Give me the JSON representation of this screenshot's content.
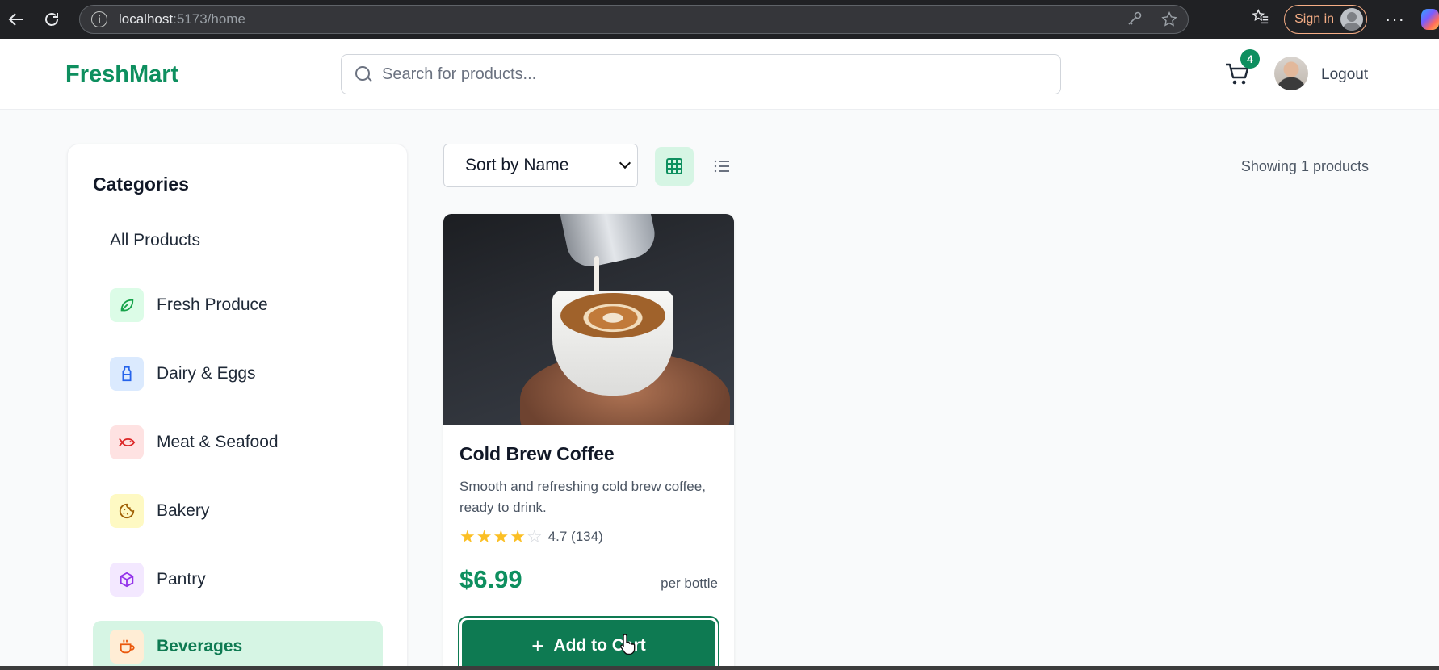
{
  "browser": {
    "url_host": "localhost",
    "url_rest": ":5173/home",
    "signin_label": "Sign in",
    "more_label": "···"
  },
  "header": {
    "logo": "FreshMart",
    "search_placeholder": "Search for products...",
    "cart_count": "4",
    "logout_label": "Logout"
  },
  "sidebar": {
    "title": "Categories",
    "items": [
      {
        "label": "All Products",
        "icon": "none",
        "color": ""
      },
      {
        "label": "Fresh Produce",
        "icon": "leaf-icon",
        "color": "#dcfce7"
      },
      {
        "label": "Dairy & Eggs",
        "icon": "milk-bottle-icon",
        "color": "#dbeafe"
      },
      {
        "label": "Meat & Seafood",
        "icon": "fish-icon",
        "color": "#fee2e2"
      },
      {
        "label": "Bakery",
        "icon": "cookie-icon",
        "color": "#fef9c3"
      },
      {
        "label": "Pantry",
        "icon": "package-icon",
        "color": "#f3e8ff"
      },
      {
        "label": "Beverages",
        "icon": "coffee-cup-icon",
        "color": "#ffedd5",
        "active": true
      }
    ]
  },
  "toolbar": {
    "sort_value": "Sort by Name",
    "showing_text": "Showing 1 products"
  },
  "product": {
    "name": "Cold Brew Coffee",
    "description": "Smooth and refreshing cold brew coffee, ready to drink.",
    "rating": "4.7",
    "rating_count": "(134)",
    "stars_filled": 4,
    "stars_total": 5,
    "price": "$6.99",
    "unit": "per bottle",
    "add_label": "Add to Cart"
  },
  "colors": {
    "brand": "#0e8f5f",
    "button": "#0e7a52",
    "active_bg": "#d6f5e4"
  }
}
